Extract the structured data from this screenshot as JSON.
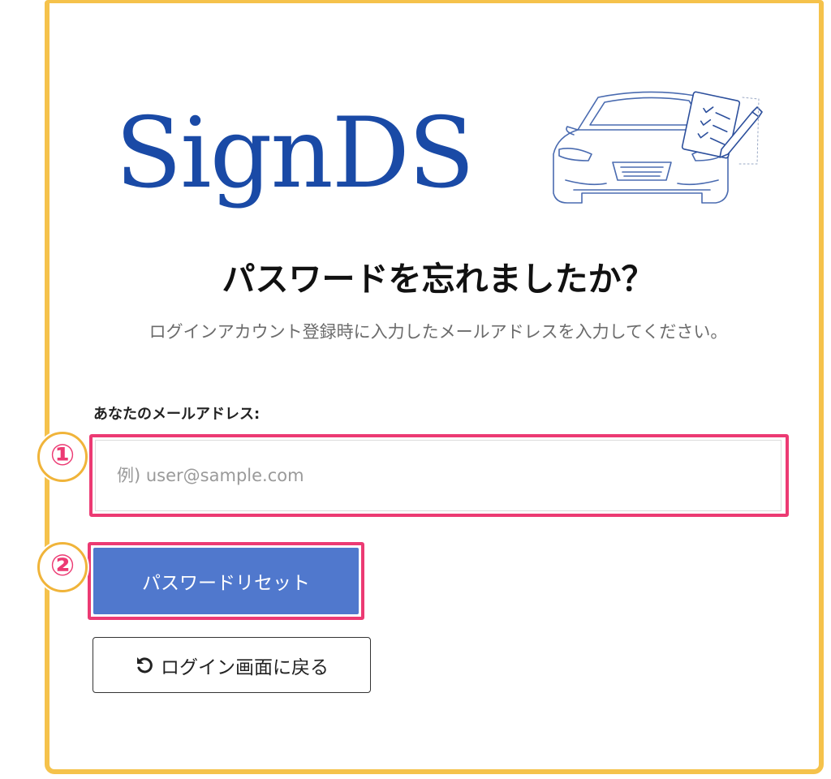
{
  "logo": {
    "text": "SignDS",
    "color": "#1a4aa6",
    "illustration": "car-with-checklist-icon"
  },
  "title": "パスワードを忘れましたか？",
  "subtitle": "ログインアカウント登録時に入力したメールアドレスを入力してください。",
  "form": {
    "email_label": "あなたのメールアドレス:",
    "email_placeholder": "例) user@sample.com",
    "email_value": "",
    "reset_button_label": "パスワードリセット",
    "back_button_label": "ログイン画面に戻る",
    "back_icon": "undo-icon"
  },
  "annotations": {
    "marker_1": "①",
    "marker_2": "②",
    "highlight_color": "#ec3a73",
    "frame_color": "#f5c24b"
  },
  "colors": {
    "primary_button": "#5078cd"
  }
}
